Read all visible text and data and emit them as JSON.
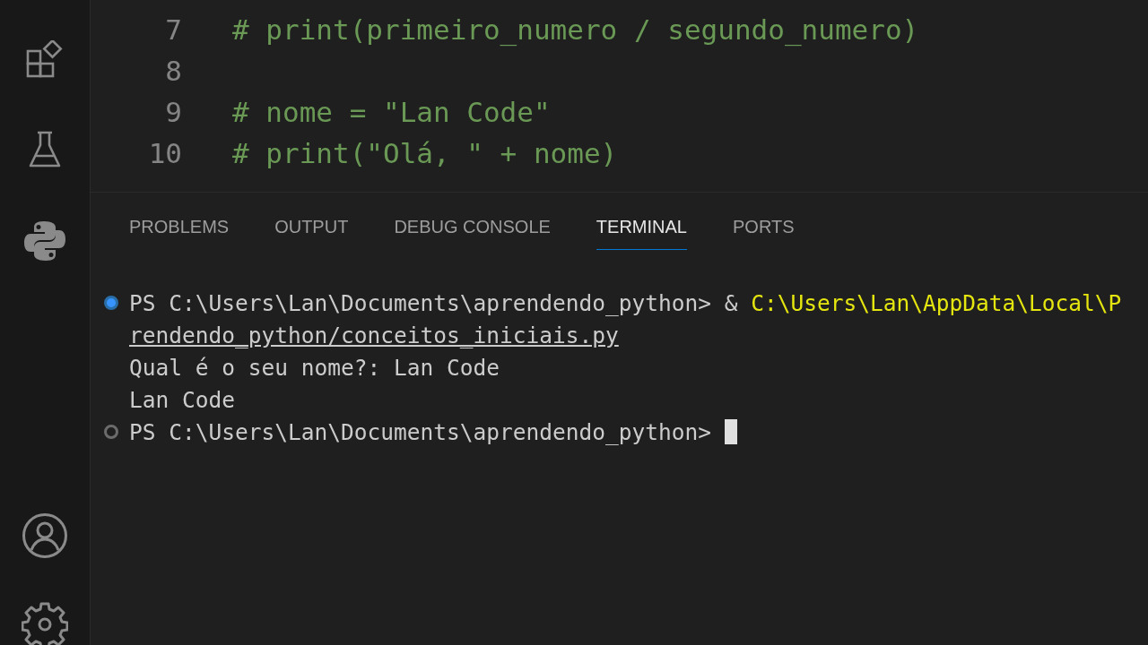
{
  "activity_bar": {
    "items": [
      {
        "kind": "extensions"
      },
      {
        "kind": "testing"
      },
      {
        "kind": "python"
      }
    ],
    "bottom_items": [
      {
        "kind": "account"
      },
      {
        "kind": "settings"
      }
    ]
  },
  "editor": {
    "lines": [
      {
        "number": "7",
        "code": "# print(primeiro_numero / segundo_numero)"
      },
      {
        "number": "8"
      },
      {
        "number": "9",
        "code": "# nome = \"Lan Code\""
      },
      {
        "number": "10",
        "code": "# print(\"Olá, \" + nome)"
      }
    ]
  },
  "panel": {
    "tabs": [
      {
        "label": "PROBLEMS",
        "selected": false
      },
      {
        "label": "OUTPUT",
        "selected": false
      },
      {
        "label": "DEBUG CONSOLE",
        "selected": false
      },
      {
        "label": "TERMINAL",
        "selected": true
      },
      {
        "label": "PORTS",
        "selected": false
      }
    ],
    "terminal": {
      "lines": [
        {
          "kind": "command",
          "completed": true,
          "segments": [
            {
              "kind": "prompt",
              "text": "PS C:\\Users\\Lan\\Documents\\aprendendo_python>"
            },
            {
              "kind": "operator",
              "text": "&"
            },
            {
              "kind": "path",
              "text": "C:\\Users\\Lan\\AppData\\Local\\P"
            }
          ]
        },
        {
          "kind": "output",
          "segments": [
            {
              "kind": "link",
              "text": "rendendo_python/conceitos_iniciais.py"
            }
          ]
        },
        {
          "kind": "output",
          "segments": [
            {
              "kind": "output",
              "text": "Qual é o seu nome?: Lan Code"
            }
          ]
        },
        {
          "kind": "output",
          "segments": [
            {
              "kind": "output",
              "text": "Lan Code"
            }
          ]
        },
        {
          "kind": "command",
          "completed": false,
          "cursor": true,
          "segments": [
            {
              "kind": "prompt",
              "text": "PS C:\\Users\\Lan\\Documents\\aprendendo_python>"
            }
          ]
        }
      ]
    }
  }
}
